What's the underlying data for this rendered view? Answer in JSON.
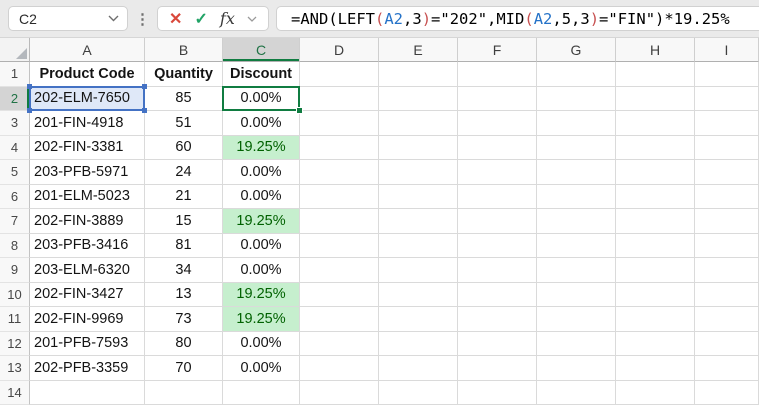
{
  "formula_bar": {
    "cell_reference": "C2",
    "cancel_glyph": "✕",
    "confirm_glyph": "✓",
    "insert_function_label": "fx",
    "formula_text": "=AND(LEFT(A2,3)=\"202\",MID(A2,5,3)=\"FIN\")*19.25%",
    "formula_tokens": [
      {
        "text": "=AND(LEFT",
        "color": "#000000"
      },
      {
        "text": "(",
        "color": "#c75050"
      },
      {
        "text": "A2",
        "color": "#2472c8"
      },
      {
        "text": ",3",
        "color": "#000000"
      },
      {
        "text": ")",
        "color": "#c75050"
      },
      {
        "text": "=\"202\",MID",
        "color": "#000000"
      },
      {
        "text": "(",
        "color": "#c75050"
      },
      {
        "text": "A2",
        "color": "#2472c8"
      },
      {
        "text": ",5,3",
        "color": "#000000"
      },
      {
        "text": ")",
        "color": "#c75050"
      },
      {
        "text": "=\"FIN\"",
        "color": "#000000"
      },
      {
        "text": ")*19.25%",
        "color": "#000000"
      }
    ]
  },
  "grid": {
    "columns": [
      "A",
      "B",
      "C",
      "D",
      "E",
      "F",
      "G",
      "H",
      "I"
    ],
    "selected_column": "C",
    "selected_row": "2",
    "active_cell": "C2",
    "referenced_cell": "A2",
    "rows": [
      {
        "n": "1",
        "a": "Product Code",
        "b": "Quantity",
        "c": "Discount",
        "bold": true,
        "green": false
      },
      {
        "n": "2",
        "a": "202-ELM-7650",
        "b": "85",
        "c": "0.00%",
        "bold": false,
        "green": false
      },
      {
        "n": "3",
        "a": "201-FIN-4918",
        "b": "51",
        "c": "0.00%",
        "bold": false,
        "green": false
      },
      {
        "n": "4",
        "a": "202-FIN-3381",
        "b": "60",
        "c": "19.25%",
        "bold": false,
        "green": true
      },
      {
        "n": "5",
        "a": "203-PFB-5971",
        "b": "24",
        "c": "0.00%",
        "bold": false,
        "green": false
      },
      {
        "n": "6",
        "a": "201-ELM-5023",
        "b": "21",
        "c": "0.00%",
        "bold": false,
        "green": false
      },
      {
        "n": "7",
        "a": "202-FIN-3889",
        "b": "15",
        "c": "19.25%",
        "bold": false,
        "green": true
      },
      {
        "n": "8",
        "a": "203-PFB-3416",
        "b": "81",
        "c": "0.00%",
        "bold": false,
        "green": false
      },
      {
        "n": "9",
        "a": "203-ELM-6320",
        "b": "34",
        "c": "0.00%",
        "bold": false,
        "green": false
      },
      {
        "n": "10",
        "a": "202-FIN-3427",
        "b": "13",
        "c": "19.25%",
        "bold": false,
        "green": true
      },
      {
        "n": "11",
        "a": "202-FIN-9969",
        "b": "73",
        "c": "19.25%",
        "bold": false,
        "green": true
      },
      {
        "n": "12",
        "a": "201-PFB-7593",
        "b": "80",
        "c": "0.00%",
        "bold": false,
        "green": false
      },
      {
        "n": "13",
        "a": "202-PFB-3359",
        "b": "70",
        "c": "0.00%",
        "bold": false,
        "green": false
      },
      {
        "n": "14",
        "a": "",
        "b": "",
        "c": "",
        "bold": false,
        "green": false
      }
    ]
  },
  "colors": {
    "excel_green": "#107C41",
    "selected_header_text": "#217346",
    "highlight_cell_bg": "#C6EFCE",
    "highlight_cell_text": "#006100",
    "reference_blue": "#4472C4",
    "reference_fill": "#DFE8F8",
    "formula_reference_text": "#2472C8",
    "formula_paren_red": "#C75050",
    "cancel_red": "#D9483B",
    "confirm_green": "#21A366"
  }
}
